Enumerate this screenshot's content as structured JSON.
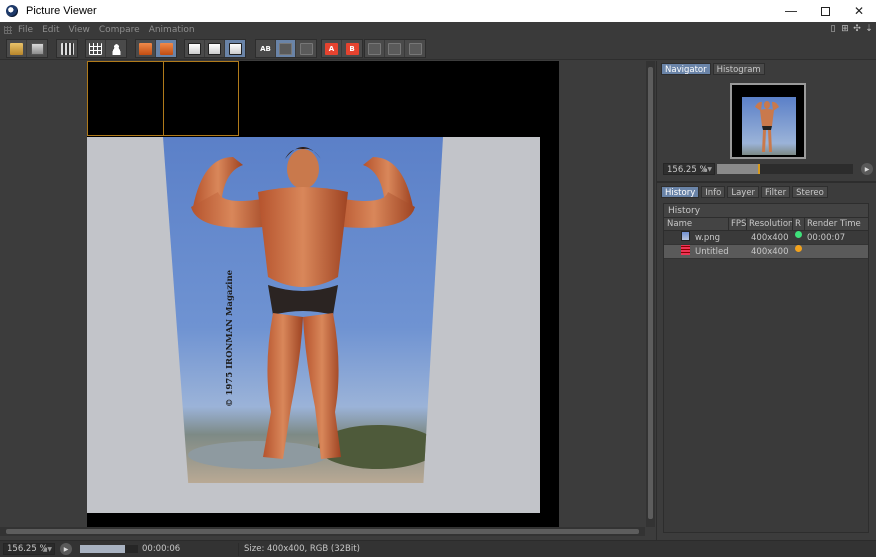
{
  "window": {
    "title": "Picture Viewer"
  },
  "menu": [
    "File",
    "Edit",
    "View",
    "Compare",
    "Animation"
  ],
  "toolbar": {
    "groups": [
      [
        "open-folder-icon",
        "save-icon"
      ],
      [
        "film-strip-icon"
      ],
      [
        "render-region-icon",
        "render-person-icon"
      ],
      [
        "stop-render-icon",
        "render-active-icon"
      ],
      [
        "show-picture-a-icon",
        "show-picture-b-icon",
        "show-ab-icon"
      ],
      [
        "ab-compare-icon",
        "ab-overlay-icon",
        "ab-text-icon"
      ],
      [
        "set-a-icon",
        "set-b-icon"
      ],
      [
        "swap-ab-icon",
        "split-ab-icon",
        "difference-ab-icon"
      ]
    ],
    "set_a_label": "A",
    "set_b_label": "B",
    "ab_label": "AB"
  },
  "image": {
    "magazine_credit": "© 1975 IRONMAN Magazine"
  },
  "navigator": {
    "tabs": [
      "Navigator",
      "Histogram"
    ],
    "active_tab": "Navigator",
    "zoom": "156.25 %",
    "zoom_slider_level": 0.31
  },
  "history_panel": {
    "tabs": [
      "History",
      "Info",
      "Layer",
      "Filter",
      "Stereo"
    ],
    "active_tab": "History",
    "title": "History",
    "columns": [
      "Name",
      "FPS",
      "Resolution",
      "R",
      "Render Time"
    ],
    "rows": [
      {
        "name": "w.png",
        "fps": "",
        "resolution": "400x400",
        "status_color": "#3ee07a",
        "render_time": "00:00:07",
        "selected": false
      },
      {
        "name": "Untitled",
        "fps": "",
        "resolution": "400x400",
        "status_color": "#f2a21c",
        "render_time": "",
        "selected": true
      }
    ]
  },
  "status": {
    "zoom": "156.25 %",
    "progress": 0.78,
    "time": "00:00:06",
    "info": "Size: 400x400, RGB (32Bit)"
  },
  "colors": {
    "accent": "#6a84a8",
    "tile_outline": "#b07a1a"
  }
}
